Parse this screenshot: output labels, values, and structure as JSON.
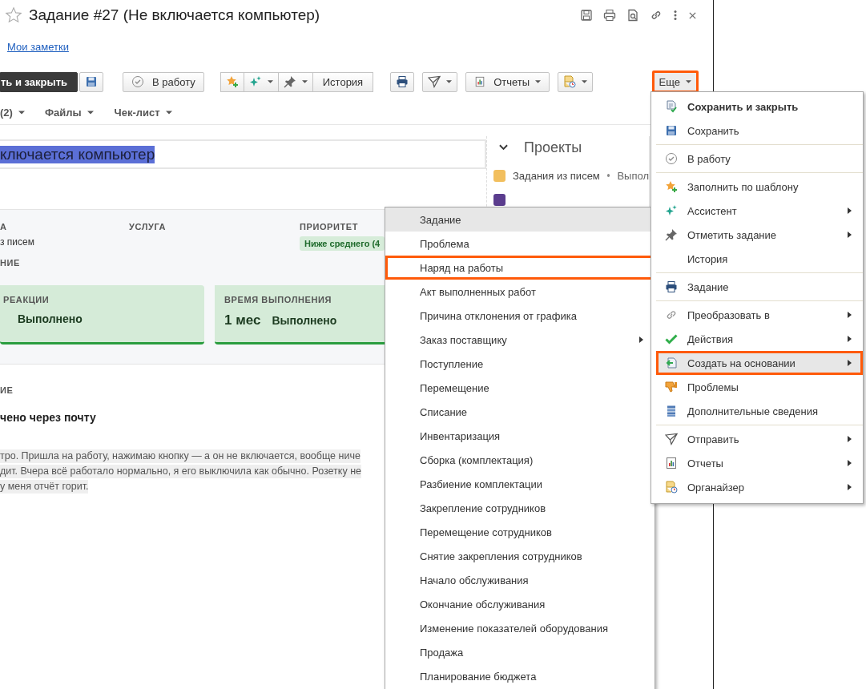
{
  "window": {
    "title": "Задание #27 (Не включается компьютер)",
    "favorite": false
  },
  "notes_link": "Мои заметки",
  "toolbar": {
    "save_close": "ть и закрыть",
    "start_work": "В работу",
    "history": "История",
    "reports": "Отчеты",
    "more": {
      "label": "Еще",
      "outlined": true
    }
  },
  "tabs": [
    {
      "label": "(2)"
    },
    {
      "label": "Файлы"
    },
    {
      "label": "Чек-лист"
    }
  ],
  "subject": {
    "value": "ключается компьютер",
    "selected": true
  },
  "details": {
    "fields": [
      {
        "label": "А",
        "value": "з писем"
      },
      {
        "label": "УСЛУГА"
      },
      {
        "label": "ПРИОРИТЕТ",
        "badge": "Ниже среднего (4"
      }
    ],
    "section": "НИЕ",
    "cards": [
      {
        "title": "РЕАКЦИИ",
        "status": "Выполнено"
      },
      {
        "title": "ВРЕМЯ ВЫПОЛНЕНИЯ",
        "value": "1 мес",
        "status": "Выполнено"
      }
    ]
  },
  "description": {
    "label": "ИЕ",
    "source": "чено через почту",
    "lines": [
      "тро. Пришла на работу, нажимаю кнопку — а он не включается, вообще ниче",
      "дит. Вчера всё работало нормально, я его выключила как обычно. Розетку не",
      "у меня отчёт горит."
    ]
  },
  "projects": {
    "title": "Проекты",
    "expanded": true,
    "items": [
      {
        "name": "Задания из писем",
        "status": "Выпол",
        "color": "#f2bf5e"
      },
      {
        "color": "#5b3d8e"
      }
    ]
  },
  "more_menu": {
    "groups": [
      [
        {
          "label": "Сохранить и закрыть",
          "default": true,
          "submenu": false,
          "selected": false,
          "outlined": false
        },
        {
          "label": "Сохранить",
          "default": false,
          "submenu": false,
          "selected": false,
          "outlined": false
        }
      ],
      [
        {
          "label": "В работу",
          "default": false,
          "submenu": false,
          "selected": false,
          "outlined": false
        }
      ],
      [
        {
          "label": "Заполнить по шаблону",
          "default": false,
          "submenu": false,
          "selected": false,
          "outlined": false
        },
        {
          "label": "Ассистент",
          "default": false,
          "submenu": true,
          "selected": false,
          "outlined": false
        },
        {
          "label": "Отметить задание",
          "default": false,
          "submenu": true,
          "selected": false,
          "outlined": false
        },
        {
          "label": "История",
          "default": false,
          "submenu": false,
          "selected": false,
          "outlined": false
        }
      ],
      [
        {
          "label": "Задание",
          "default": false,
          "submenu": false,
          "selected": false,
          "outlined": false
        }
      ],
      [
        {
          "label": "Преобразовать в",
          "default": false,
          "submenu": true,
          "selected": false,
          "outlined": false
        },
        {
          "label": "Действия",
          "default": false,
          "submenu": true,
          "selected": false,
          "outlined": false
        },
        {
          "label": "Создать на основании",
          "default": false,
          "submenu": true,
          "selected": true,
          "outlined": true
        },
        {
          "label": "Проблемы",
          "default": false,
          "submenu": false,
          "selected": false,
          "outlined": false
        },
        {
          "label": "Дополнительные сведения",
          "default": false,
          "submenu": false,
          "selected": false,
          "outlined": false
        }
      ],
      [
        {
          "label": "Отправить",
          "default": false,
          "submenu": true,
          "selected": false,
          "outlined": false
        },
        {
          "label": "Отчеты",
          "default": false,
          "submenu": true,
          "selected": false,
          "outlined": false
        },
        {
          "label": "Органайзер",
          "default": false,
          "submenu": true,
          "selected": false,
          "outlined": false
        }
      ]
    ]
  },
  "create_menu": {
    "items": [
      {
        "label": "Задание",
        "selected": true,
        "outlined": false,
        "submenu": false
      },
      {
        "label": "Проблема",
        "selected": false,
        "outlined": false,
        "submenu": false
      },
      {
        "label": "Наряд на работы",
        "selected": false,
        "outlined": true,
        "submenu": false
      },
      {
        "label": "Акт выполненных работ",
        "selected": false,
        "outlined": false,
        "submenu": false
      },
      {
        "label": "Причина отклонения от графика",
        "selected": false,
        "outlined": false,
        "submenu": false
      },
      {
        "label": "Заказ поставщику",
        "selected": false,
        "outlined": false,
        "submenu": true
      },
      {
        "label": "Поступление",
        "selected": false,
        "outlined": false,
        "submenu": false
      },
      {
        "label": "Перемещение",
        "selected": false,
        "outlined": false,
        "submenu": false
      },
      {
        "label": "Списание",
        "selected": false,
        "outlined": false,
        "submenu": false
      },
      {
        "label": "Инвентаризация",
        "selected": false,
        "outlined": false,
        "submenu": false
      },
      {
        "label": "Сборка (комплектация)",
        "selected": false,
        "outlined": false,
        "submenu": false
      },
      {
        "label": "Разбиение комплектации",
        "selected": false,
        "outlined": false,
        "submenu": false
      },
      {
        "label": "Закрепление сотрудников",
        "selected": false,
        "outlined": false,
        "submenu": false
      },
      {
        "label": "Перемещение сотрудников",
        "selected": false,
        "outlined": false,
        "submenu": false
      },
      {
        "label": "Снятие закрепления сотрудников",
        "selected": false,
        "outlined": false,
        "submenu": false
      },
      {
        "label": "Начало обслуживания",
        "selected": false,
        "outlined": false,
        "submenu": false
      },
      {
        "label": "Окончание обслуживания",
        "selected": false,
        "outlined": false,
        "submenu": false
      },
      {
        "label": "Изменение показателей оборудования",
        "selected": false,
        "outlined": false,
        "submenu": false
      },
      {
        "label": "Продажа",
        "selected": false,
        "outlined": false,
        "submenu": false
      },
      {
        "label": "Планирование бюджета",
        "selected": false,
        "outlined": false,
        "submenu": false
      }
    ]
  }
}
